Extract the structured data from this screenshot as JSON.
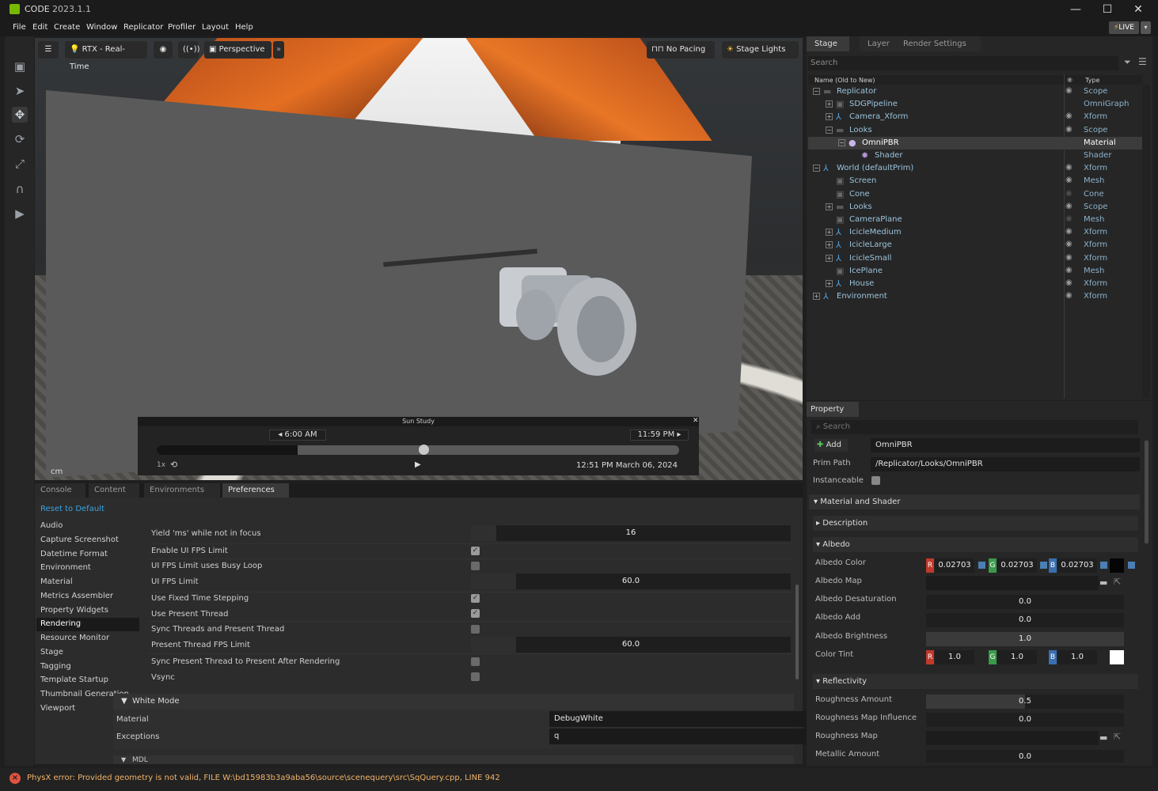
{
  "app": {
    "title": "CODE",
    "version": "2023.1.1",
    "live_label": "LIVE"
  },
  "menu": [
    "File",
    "Edit",
    "Create",
    "Window",
    "Replicator",
    "Profiler",
    "Layout",
    "Help"
  ],
  "viewport": {
    "render_mode": "RTX - Real-Time",
    "camera": "Perspective",
    "pacing": "No Pacing",
    "lights": "Stage Lights",
    "unit": "cm"
  },
  "sun_study": {
    "title": "Sun Study",
    "start_time": "6:00  AM",
    "end_time": "11:59  PM",
    "speed": "1x",
    "current": "12:51 PM March 06, 2024",
    "progress": 0.51
  },
  "bottom_tabs": [
    "Console",
    "Content",
    "Environments",
    "Preferences"
  ],
  "preferences": {
    "reset_label": "Reset to Default",
    "categories": [
      "Audio",
      "Capture Screenshot",
      "Datetime Format",
      "Environment",
      "Material",
      "Metrics Assembler",
      "Property Widgets",
      "Rendering",
      "Resource Monitor",
      "Stage",
      "Tagging",
      "Template Startup",
      "Thumbnail Generation",
      "Viewport"
    ],
    "selected_category": "Rendering",
    "rows": [
      {
        "label": "Yield 'ms' while not in focus",
        "kind": "slider",
        "value": "16",
        "fill": 0.08
      },
      {
        "label": "Enable UI FPS Limit",
        "kind": "check",
        "checked": true
      },
      {
        "label": "UI FPS Limit uses Busy Loop",
        "kind": "check",
        "checked": false
      },
      {
        "label": "UI FPS Limit",
        "kind": "slider",
        "value": "60.0",
        "fill": 0.14
      },
      {
        "label": "Use Fixed Time Stepping",
        "kind": "check",
        "checked": true
      },
      {
        "label": "Use Present Thread",
        "kind": "check",
        "checked": true
      },
      {
        "label": "Sync Threads and Present Thread",
        "kind": "check",
        "checked": false
      },
      {
        "label": "Present Thread FPS Limit",
        "kind": "slider",
        "value": "60.0",
        "fill": 0.14
      },
      {
        "label": "Sync Present Thread to Present After Rendering",
        "kind": "check",
        "checked": false
      },
      {
        "label": "Vsync",
        "kind": "check",
        "checked": false
      }
    ],
    "white_mode": {
      "header": "White Mode",
      "material_label": "Material",
      "material_value": "DebugWhite",
      "exceptions_label": "Exceptions",
      "exceptions_value": "q"
    },
    "next_header": "MDL"
  },
  "status": {
    "error": "PhysX error: Provided geometry is not valid, FILE W:\\bd15983b3a9aba56\\source\\scenequery\\src\\SqQuery.cpp, LINE 942"
  },
  "stage": {
    "tabs": [
      "Stage",
      "Layer",
      "Render Settings"
    ],
    "search_placeholder": "Search",
    "col_name": "Name (Old to New)",
    "col_type": "Type",
    "rows": [
      {
        "name": "Replicator",
        "type": "Scope",
        "indent": 0,
        "exp": "−",
        "icon": "folder",
        "eye": true
      },
      {
        "name": "SDGPipeline",
        "type": "OmniGraph",
        "indent": 1,
        "exp": "+",
        "icon": "cube",
        "eye": false
      },
      {
        "name": "Camera_Xform",
        "type": "Xform",
        "indent": 1,
        "exp": "+",
        "icon": "xform",
        "eye": true
      },
      {
        "name": "Looks",
        "type": "Scope",
        "indent": 1,
        "exp": "−",
        "icon": "folder",
        "eye": true
      },
      {
        "name": "OmniPBR",
        "type": "Material",
        "indent": 2,
        "exp": "−",
        "icon": "sphere",
        "eye": false,
        "selected": true
      },
      {
        "name": "Shader",
        "type": "Shader",
        "indent": 3,
        "exp": "",
        "icon": "gear",
        "eye": false
      },
      {
        "name": "World (defaultPrim)",
        "type": "Xform",
        "indent": 0,
        "exp": "−",
        "icon": "xform",
        "eye": true
      },
      {
        "name": "Screen",
        "type": "Mesh",
        "indent": 1,
        "exp": "",
        "icon": "cube",
        "eye": true
      },
      {
        "name": "Cone",
        "type": "Cone",
        "indent": 1,
        "exp": "",
        "icon": "cube",
        "eye": true,
        "dim": true
      },
      {
        "name": "Looks",
        "type": "Scope",
        "indent": 1,
        "exp": "+",
        "icon": "folder",
        "eye": true
      },
      {
        "name": "CameraPlane",
        "type": "Mesh",
        "indent": 1,
        "exp": "",
        "icon": "cube",
        "eye": true,
        "dim": true
      },
      {
        "name": "IcicleMedium",
        "type": "Xform",
        "indent": 1,
        "exp": "+",
        "icon": "xform2",
        "eye": true
      },
      {
        "name": "IcicleLarge",
        "type": "Xform",
        "indent": 1,
        "exp": "+",
        "icon": "xform2",
        "eye": true
      },
      {
        "name": "IcicleSmall",
        "type": "Xform",
        "indent": 1,
        "exp": "+",
        "icon": "xform2",
        "eye": true
      },
      {
        "name": "IcePlane",
        "type": "Mesh",
        "indent": 1,
        "exp": "",
        "icon": "cube",
        "eye": true
      },
      {
        "name": "House",
        "type": "Xform",
        "indent": 1,
        "exp": "+",
        "icon": "xform2",
        "eye": true
      },
      {
        "name": "Environment",
        "type": "Xform",
        "indent": 0,
        "exp": "+",
        "icon": "xform",
        "eye": true
      }
    ]
  },
  "property": {
    "tab": "Property",
    "search_placeholder": "Search",
    "add_label": "Add",
    "name_value": "OmniPBR",
    "prim_path_label": "Prim Path",
    "prim_path": "/Replicator/Looks/OmniPBR",
    "instanceable_label": "Instanceable",
    "section": "Material and Shader",
    "description": "Description",
    "albedo": "Albedo",
    "albedo_color_label": "Albedo Color",
    "albedo_color": [
      "0.02703",
      "0.02703",
      "0.02703"
    ],
    "albedo_map_label": "Albedo Map",
    "albedo_desat_label": "Albedo Desaturation",
    "albedo_desat": "0.0",
    "albedo_add_label": "Albedo Add",
    "albedo_add": "0.0",
    "albedo_bright_label": "Albedo Brightness",
    "albedo_bright": "1.0",
    "color_tint_label": "Color Tint",
    "color_tint": [
      "1.0",
      "1.0",
      "1.0"
    ],
    "reflectivity": "Reflectivity",
    "rough_amount_label": "Roughness Amount",
    "rough_amount": "0.5",
    "rough_influence_label": "Roughness Map Influence",
    "rough_influence": "0.0",
    "rough_map_label": "Roughness Map",
    "metallic_label": "Metallic Amount",
    "metallic": "0.0"
  }
}
